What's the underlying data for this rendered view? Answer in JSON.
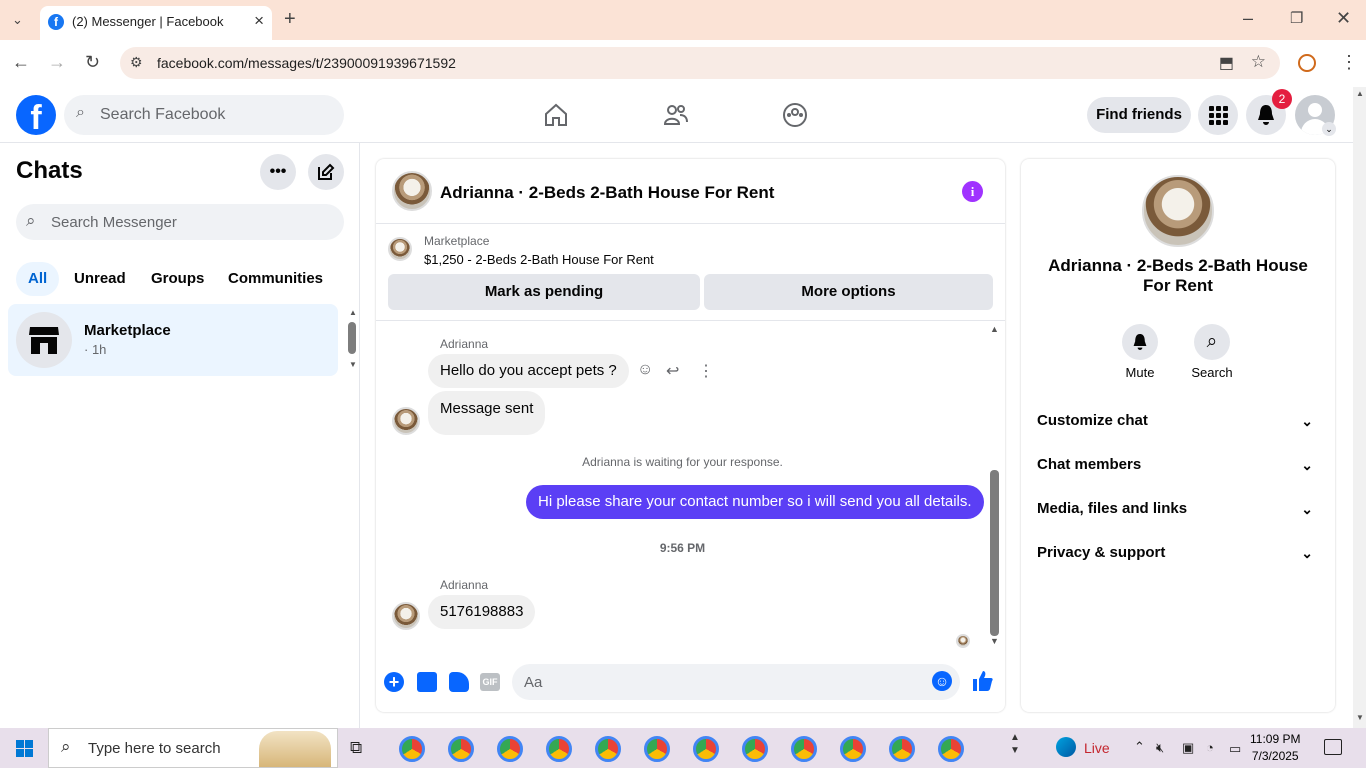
{
  "browser": {
    "tab_title": "(2) Messenger | Facebook",
    "url": "facebook.com/messages/t/23900091939671592"
  },
  "fb": {
    "search_placeholder": "Search Facebook",
    "find_friends": "Find friends",
    "notification_count": "2"
  },
  "chats": {
    "title": "Chats",
    "search_placeholder": "Search Messenger",
    "filters": [
      "All",
      "Unread",
      "Groups",
      "Communities"
    ],
    "items": [
      {
        "name": "Marketplace",
        "subtitle": "· 1h"
      }
    ]
  },
  "conversation": {
    "title": "Adrianna · 2-Beds 2-Bath House For Rent",
    "marketplace_label": "Marketplace",
    "listing": "$1,250 - 2-Beds 2-Bath House For Rent",
    "mark_pending": "Mark as pending",
    "more_options": "More options",
    "messages": {
      "sender1": "Adrianna",
      "msg1": "Hello do you accept pets ?",
      "msg2": "Message sent",
      "waiting": "Adrianna is waiting for your response.",
      "mine": "Hi please share your contact number so i will send you all details.",
      "time": "9:56 PM",
      "sender2": "Adrianna",
      "msg3": "5176198883"
    },
    "composer_placeholder": "Aa",
    "gif_label": "GIF"
  },
  "info": {
    "title": "Adrianna · 2-Beds 2-Bath House For Rent",
    "mute": "Mute",
    "search": "Search",
    "sections": [
      "Customize chat",
      "Chat members",
      "Media, files and links",
      "Privacy & support"
    ]
  },
  "taskbar": {
    "search_placeholder": "Type here to search",
    "live_label": "Live",
    "time": "11:09 PM",
    "date": "7/3/2025"
  },
  "colors": {
    "accent": "#0866ff",
    "my_bubble": "#5b3ff5",
    "info": "#a033ff"
  }
}
